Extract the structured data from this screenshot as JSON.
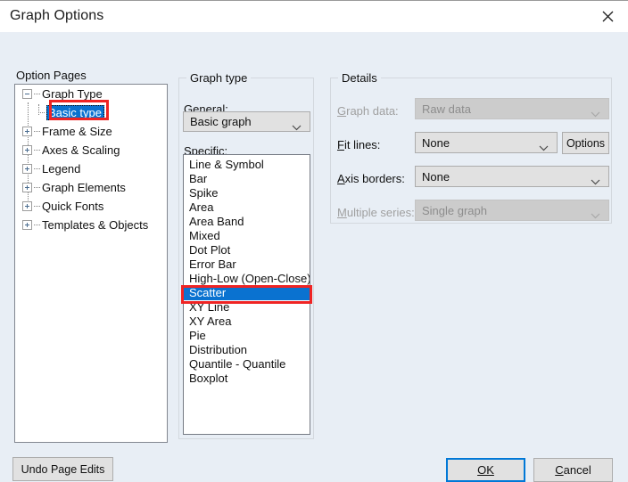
{
  "window": {
    "title": "Graph Options",
    "close_icon": "close-icon"
  },
  "option_pages": {
    "label": "Option Pages",
    "tree": [
      {
        "label": "Graph Type",
        "expander": "minus",
        "level": 0,
        "selected": false
      },
      {
        "label": "Basic type",
        "expander": "none",
        "level": 1,
        "selected": true
      },
      {
        "label": "Frame & Size",
        "expander": "plus",
        "level": 0,
        "selected": false
      },
      {
        "label": "Axes & Scaling",
        "expander": "plus",
        "level": 0,
        "selected": false
      },
      {
        "label": "Legend",
        "expander": "plus",
        "level": 0,
        "selected": false
      },
      {
        "label": "Graph Elements",
        "expander": "plus",
        "level": 0,
        "selected": false
      },
      {
        "label": "Quick Fonts",
        "expander": "plus",
        "level": 0,
        "selected": false
      },
      {
        "label": "Templates & Objects",
        "expander": "plus",
        "level": 0,
        "selected": false
      }
    ]
  },
  "graph_type": {
    "group_label": "Graph type",
    "general_label": "General:",
    "general_value": "Basic graph",
    "general_options": [
      "Basic graph"
    ],
    "specific_label": "Specific:",
    "specific_selected": "Scatter",
    "specific_items": [
      "Line & Symbol",
      "Bar",
      "Spike",
      "Area",
      "Area Band",
      "Mixed",
      "Dot Plot",
      "Error Bar",
      "High-Low (Open-Close)",
      "Scatter",
      "XY Line",
      "XY Area",
      "Pie",
      "Distribution",
      "Quantile - Quantile",
      "Boxplot"
    ]
  },
  "details": {
    "group_label": "Details",
    "graph_data_label": "Graph data:",
    "graph_data_value": "Raw data",
    "graph_data_disabled": true,
    "fit_lines_label": "Fit lines:",
    "fit_lines_value": "None",
    "fit_lines_disabled": false,
    "options_button": "Options",
    "axis_borders_label": "Axis borders:",
    "axis_borders_value": "None",
    "axis_borders_disabled": false,
    "multiple_series_label": "Multiple series:",
    "multiple_series_value": "Single graph",
    "multiple_series_disabled": true
  },
  "footer": {
    "undo_label": "Undo Page Edits",
    "ok_label": "OK",
    "cancel_label": "Cancel"
  },
  "annotations": {
    "color": "#ef2424",
    "boxes": [
      "basic-type-highlight",
      "scatter-highlight"
    ]
  },
  "colors": {
    "dialog_background": "#e8eef5",
    "titlebar_background": "#ffffff",
    "selection_blue": "#0a72d0",
    "focus_blue": "#0078d7",
    "annotation_red": "#ef2424",
    "control_face": "#e1e1e1",
    "disabled_face": "#cccccc"
  }
}
